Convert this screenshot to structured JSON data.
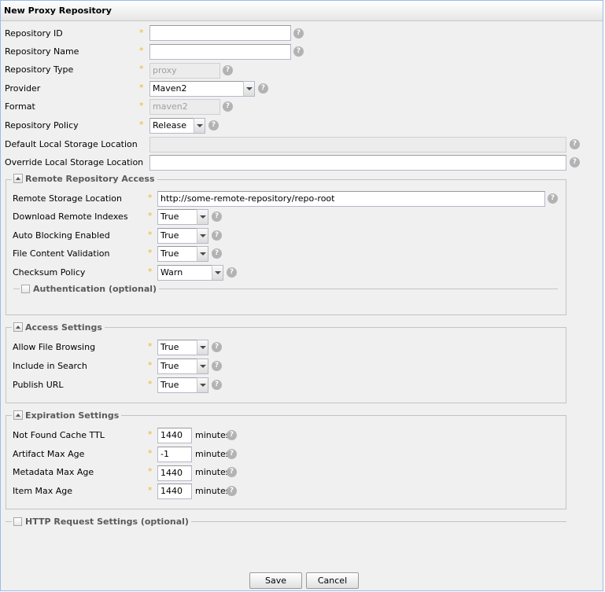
{
  "panel": {
    "title": "New Proxy Repository"
  },
  "form": {
    "repository_id": {
      "label": "Repository ID",
      "value": ""
    },
    "repository_name": {
      "label": "Repository Name",
      "value": ""
    },
    "repository_type": {
      "label": "Repository Type",
      "value": "proxy"
    },
    "provider": {
      "label": "Provider",
      "value": "Maven2"
    },
    "format": {
      "label": "Format",
      "value": "maven2"
    },
    "repository_policy": {
      "label": "Repository Policy",
      "value": "Release"
    },
    "default_storage": {
      "label": "Default Local Storage Location",
      "value": ""
    },
    "override_storage": {
      "label": "Override Local Storage Location",
      "value": ""
    }
  },
  "remote": {
    "legend": "Remote Repository Access",
    "storage_location": {
      "label": "Remote Storage Location",
      "value": "http://some-remote-repository/repo-root"
    },
    "download_indexes": {
      "label": "Download Remote Indexes",
      "value": "True"
    },
    "auto_blocking": {
      "label": "Auto Blocking Enabled",
      "value": "True"
    },
    "content_validation": {
      "label": "File Content Validation",
      "value": "True"
    },
    "checksum_policy": {
      "label": "Checksum Policy",
      "value": "Warn"
    },
    "authentication_label": "Authentication (optional)"
  },
  "access": {
    "legend": "Access Settings",
    "allow_browsing": {
      "label": "Allow File Browsing",
      "value": "True"
    },
    "include_search": {
      "label": "Include in Search",
      "value": "True"
    },
    "publish_url": {
      "label": "Publish URL",
      "value": "True"
    }
  },
  "expiration": {
    "legend": "Expiration Settings",
    "unit": "minutes",
    "not_found_ttl": {
      "label": "Not Found Cache TTL",
      "value": "1440"
    },
    "artifact_max_age": {
      "label": "Artifact Max Age",
      "value": "-1"
    },
    "metadata_max_age": {
      "label": "Metadata Max Age",
      "value": "1440"
    },
    "item_max_age": {
      "label": "Item Max Age",
      "value": "1440"
    }
  },
  "http_settings_label": "HTTP Request Settings (optional)",
  "buttons": {
    "save": "Save",
    "cancel": "Cancel"
  },
  "icons": {
    "required": "asterisk",
    "help": "question-mark-icon"
  },
  "colors": {
    "required_star": "#f3b32a",
    "help_icon": "#b3b3b3",
    "panel_border": "#99bbe8"
  }
}
